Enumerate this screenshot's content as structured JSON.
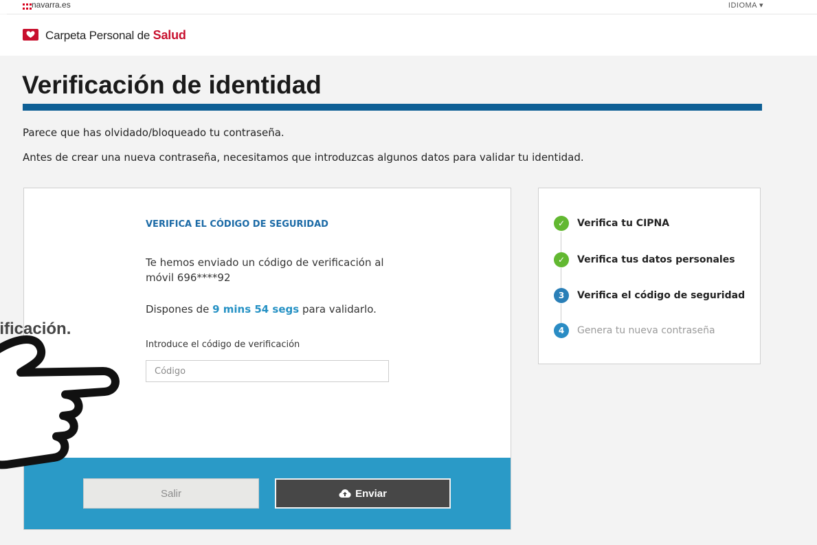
{
  "topbar": {
    "brand": "navarra.es",
    "language_label": "IDIOMA ▾"
  },
  "header": {
    "logo_prefix": "Carpeta Personal de ",
    "logo_emphasis": "Salud"
  },
  "page": {
    "title": "Verificación de identidad",
    "intro_line1": "Parece que has olvidado/bloqueado tu contraseña.",
    "intro_line2": "Antes de crear una nueva contraseña, necesitamos que introduzcas algunos datos para validar tu identidad."
  },
  "verification": {
    "section_title": "VERIFICA EL CÓDIGO DE SEGURIDAD",
    "sent_message": "Te hemos enviado un código de verificación al móvil 696****92",
    "time_prefix": "Dispones de ",
    "time_remaining": "9 mins 54 segs",
    "time_suffix": " para validarlo.",
    "code_label": "Introduce el código de verificación",
    "code_placeholder": "Código",
    "code_value": ""
  },
  "buttons": {
    "exit_label": "Salir",
    "send_label": "Enviar"
  },
  "steps": [
    {
      "label": "Verifica tu CIPNA",
      "status": "done",
      "marker": "✓"
    },
    {
      "label": "Verifica tus datos personales",
      "status": "done",
      "marker": "✓"
    },
    {
      "label": "Verifica el código de seguridad",
      "status": "current",
      "marker": "3"
    },
    {
      "label": "Genera tu nueva contraseña",
      "status": "pending",
      "marker": "4"
    }
  ],
  "overlay": {
    "caption": "rificación."
  },
  "icons": {
    "logo": "heart-folder-icon",
    "send": "cloud-upload-icon",
    "done": "check-circle-icon",
    "pointer": "pointing-hand-icon"
  },
  "colors": {
    "brand_red": "#c8102e",
    "title_rule": "#0e5f95",
    "accent_blue": "#2a9ac7",
    "done_green": "#62b831",
    "step_blue": "#2a7fb7",
    "send_button": "#474747"
  }
}
